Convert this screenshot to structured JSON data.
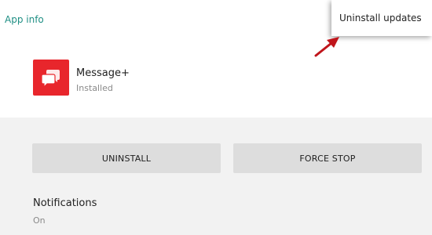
{
  "header": {
    "title": "App info"
  },
  "app": {
    "name": "Message+",
    "status": "Installed",
    "icon": "message-bubble-icon",
    "icon_color": "#e8262c"
  },
  "actions": {
    "uninstall_label": "UNINSTALL",
    "force_stop_label": "FORCE STOP"
  },
  "notifications": {
    "title": "Notifications",
    "value": "On"
  },
  "overflow_menu": {
    "items": [
      {
        "label": "Uninstall updates"
      }
    ]
  },
  "annotation": {
    "icon": "red-arrow-icon",
    "color": "#c0151b"
  },
  "colors": {
    "accent": "#1f8f84",
    "button_bg": "#dddddd",
    "page_bg": "#f2f2f2"
  }
}
